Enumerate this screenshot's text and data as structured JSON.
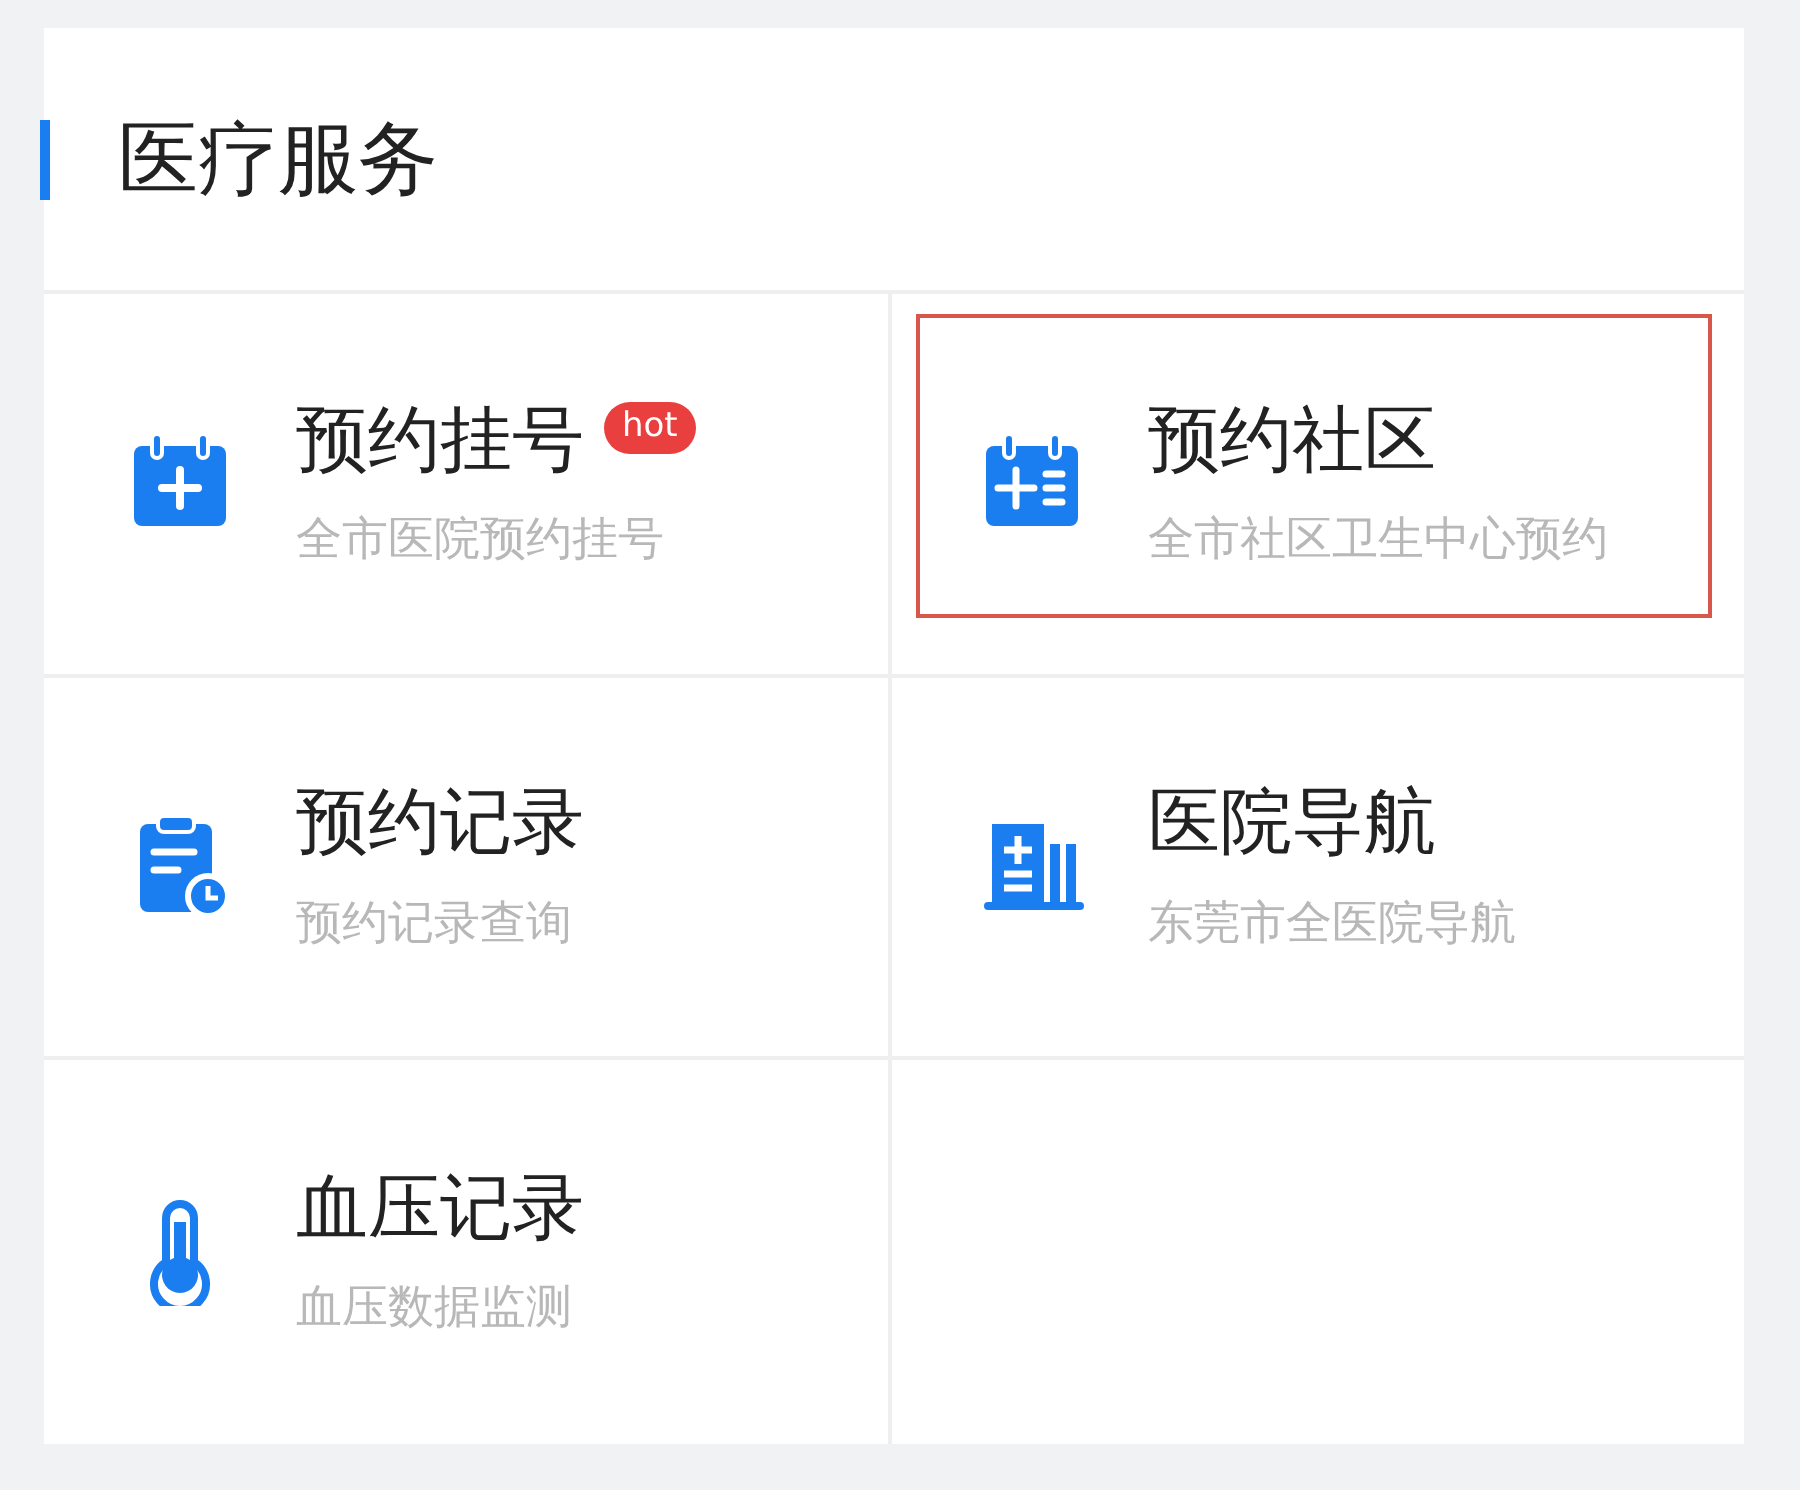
{
  "section": {
    "title": "医疗服务"
  },
  "services": [
    {
      "kind": "calendar-plus",
      "title": "预约挂号",
      "subtitle": "全市医院预约挂号",
      "badge": "hot",
      "highlighted": false
    },
    {
      "kind": "calendar-list",
      "title": "预约社区",
      "subtitle": "全市社区卫生中心预约",
      "highlighted": true
    },
    {
      "kind": "clipboard-clock",
      "title": "预约记录",
      "subtitle": "预约记录查询",
      "highlighted": false
    },
    {
      "kind": "building",
      "title": "医院导航",
      "subtitle": "东莞市全医院导航",
      "highlighted": false
    },
    {
      "kind": "thermometer",
      "title": "血压记录",
      "subtitle": "血压数据监测",
      "highlighted": false
    }
  ]
}
